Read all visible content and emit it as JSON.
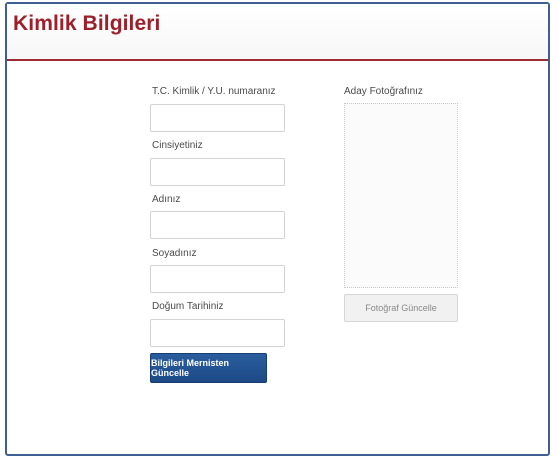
{
  "header": {
    "title": "Kimlik Bilgileri"
  },
  "form": {
    "tc_label": "T.C. Kimlik / Y.U. numaranız",
    "tc_value": "",
    "gender_label": "Cinsiyetiniz",
    "gender_value": "",
    "name_label": "Adınız",
    "name_value": "",
    "surname_label": "Soyadınız",
    "surname_value": "",
    "birth_label": "Doğum Tarihiniz",
    "birth_value": "",
    "update_button": "Bilgileri Mernisten Güncelle"
  },
  "photo": {
    "label": "Aday Fotoğrafınız",
    "update_button": "Fotoğraf Güncelle"
  },
  "colors": {
    "title": "#9c1f2b",
    "header_rule": "#9d2b34",
    "frame_border": "#3f5f93",
    "primary_button": "#1d4a86"
  }
}
